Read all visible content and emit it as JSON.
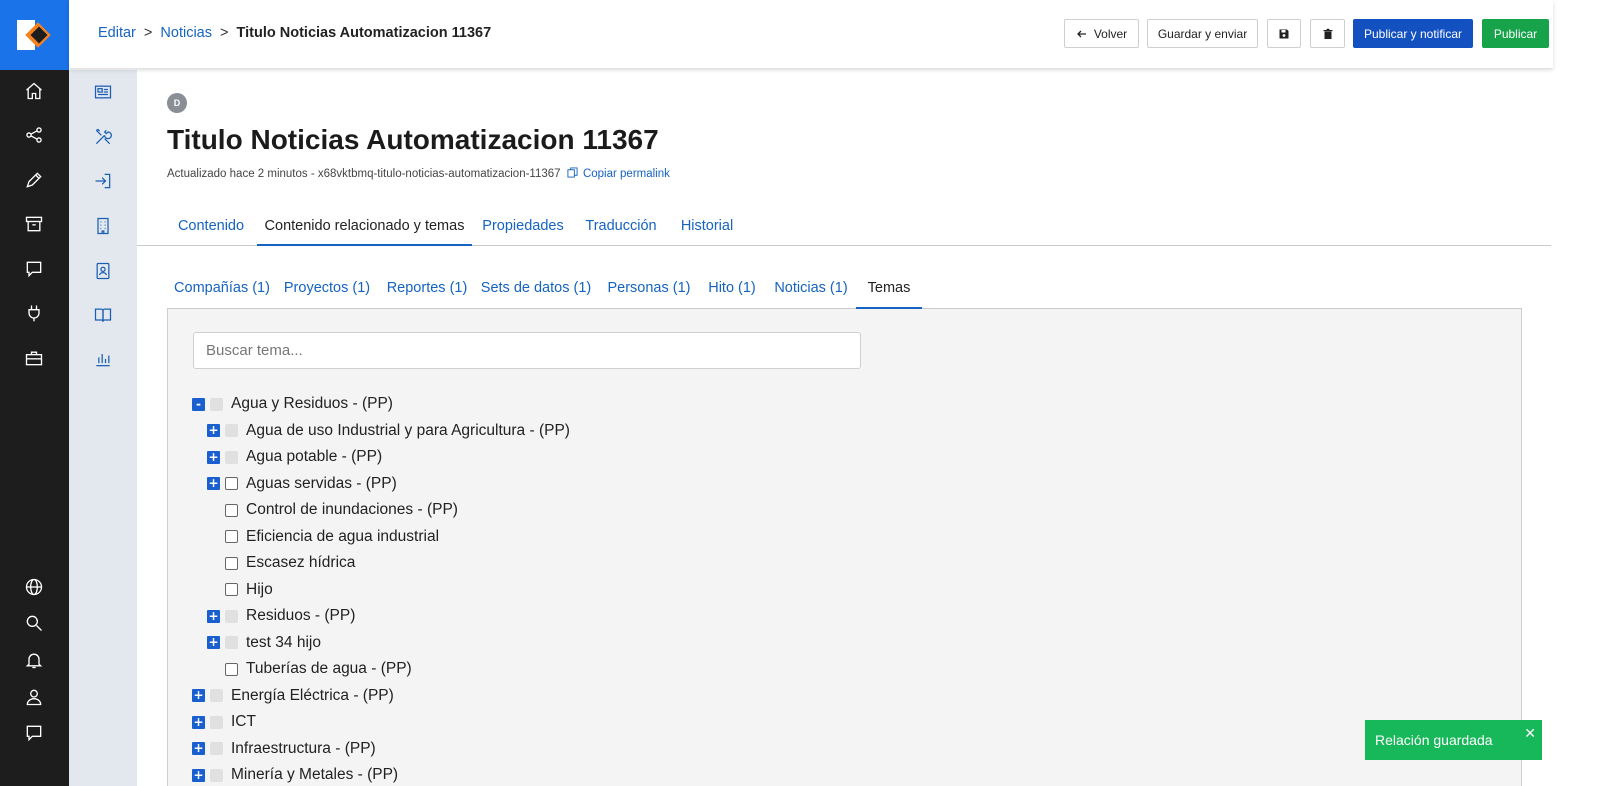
{
  "breadcrumb": {
    "items": [
      "Editar",
      "Noticias"
    ],
    "separator": ">",
    "current": "Titulo Noticias Automatizacion 11367"
  },
  "actions": {
    "back": "Volver",
    "save_send": "Guardar y enviar",
    "publish_notify": "Publicar y notificar",
    "publish": "Publicar"
  },
  "document": {
    "avatar_initial": "D",
    "title": "Titulo Noticias Automatizacion 11367",
    "meta": "Actualizado hace 2 minutos - x68vktbmq-titulo-noticias-automatizacion-11367",
    "permalink_label": "Copiar permalink"
  },
  "main_tabs": [
    {
      "label": "Contenido",
      "active": false
    },
    {
      "label": "Contenido relacionado y temas",
      "active": true
    },
    {
      "label": "Propiedades",
      "active": false
    },
    {
      "label": "Traducción",
      "active": false
    },
    {
      "label": "Historial",
      "active": false
    }
  ],
  "sub_tabs": [
    {
      "label": "Compañías (1)",
      "active": false
    },
    {
      "label": "Proyectos (1)",
      "active": false
    },
    {
      "label": "Reportes (1)",
      "active": false
    },
    {
      "label": "Sets de datos (1)",
      "active": false
    },
    {
      "label": "Personas (1)",
      "active": false
    },
    {
      "label": "Hito (1)",
      "active": false
    },
    {
      "label": "Noticias (1)",
      "active": false
    },
    {
      "label": "Temas",
      "active": true
    }
  ],
  "search": {
    "placeholder": "Buscar tema...",
    "value": ""
  },
  "tree": [
    {
      "label": "Agua y Residuos - (PP)",
      "level": 0,
      "toggle": "-",
      "checkbox": "disabled"
    },
    {
      "label": "Agua de uso Industrial y para Agricultura - (PP)",
      "level": 1,
      "toggle": "+",
      "checkbox": "disabled"
    },
    {
      "label": "Agua potable - (PP)",
      "level": 1,
      "toggle": "+",
      "checkbox": "disabled"
    },
    {
      "label": "Aguas servidas - (PP)",
      "level": 1,
      "toggle": "+",
      "checkbox": "empty"
    },
    {
      "label": "Control de inundaciones - (PP)",
      "level": 1,
      "toggle": "",
      "checkbox": "empty"
    },
    {
      "label": "Eficiencia de agua industrial",
      "level": 1,
      "toggle": "",
      "checkbox": "empty"
    },
    {
      "label": "Escasez hídrica",
      "level": 1,
      "toggle": "",
      "checkbox": "empty"
    },
    {
      "label": "Hijo",
      "level": 1,
      "toggle": "",
      "checkbox": "empty"
    },
    {
      "label": "Residuos - (PP)",
      "level": 1,
      "toggle": "+",
      "checkbox": "disabled"
    },
    {
      "label": "test 34 hijo",
      "level": 1,
      "toggle": "+",
      "checkbox": "disabled"
    },
    {
      "label": "Tuberías de agua - (PP)",
      "level": 1,
      "toggle": "",
      "checkbox": "empty"
    },
    {
      "label": "Energía Eléctrica - (PP)",
      "level": 0,
      "toggle": "+",
      "checkbox": "disabled"
    },
    {
      "label": "ICT",
      "level": 0,
      "toggle": "+",
      "checkbox": "disabled"
    },
    {
      "label": "Infraestructura - (PP)",
      "level": 0,
      "toggle": "+",
      "checkbox": "disabled"
    },
    {
      "label": "Minería y Metales - (PP)",
      "level": 0,
      "toggle": "+",
      "checkbox": "disabled"
    }
  ],
  "toast": {
    "message": "Relación guardada",
    "close": "✕"
  },
  "colors": {
    "brand_blue": "#1a73e8",
    "link": "#1563c2",
    "primary_button": "#1350c0",
    "success": "#16a34a",
    "toast": "#17b85a",
    "rail_dark": "#1d1d1d",
    "rail_light": "#e3e8ee"
  },
  "icons": {
    "main_rail_top": [
      "home-icon",
      "share-nodes-icon",
      "pencil-icon",
      "archive-icon",
      "chat-icon",
      "plug-icon",
      "toolbox-icon"
    ],
    "main_rail_bottom": [
      "globe-icon",
      "search-icon",
      "bell-icon",
      "user-icon",
      "message-icon"
    ],
    "secondary_rail": [
      "newspaper-icon",
      "tools-icon",
      "sign-in-icon",
      "building-icon",
      "contact-card-icon",
      "book-icon",
      "bar-chart-icon"
    ]
  }
}
